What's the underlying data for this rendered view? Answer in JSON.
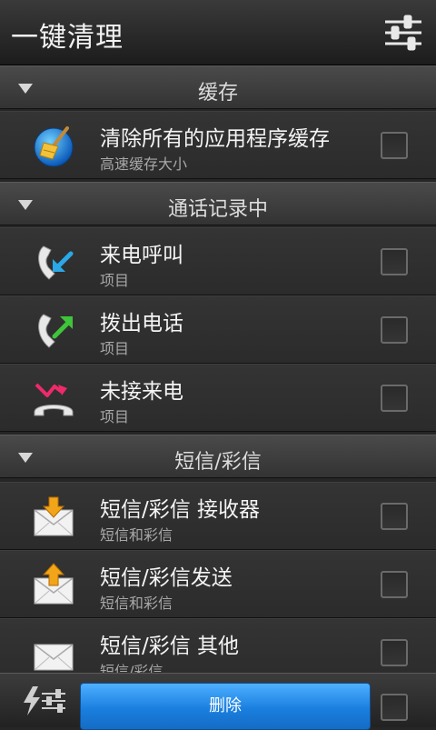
{
  "title": "一键清理",
  "sections": [
    {
      "label": "缓存",
      "items": [
        {
          "title": "清除所有的应用程序缓存",
          "subtitle": "高速缓存大小",
          "icon": "broom-icon"
        }
      ]
    },
    {
      "label": "通话记录中",
      "items": [
        {
          "title": "来电呼叫",
          "subtitle": "项目",
          "icon": "incoming-call-icon"
        },
        {
          "title": "拨出电话",
          "subtitle": "项目",
          "icon": "outgoing-call-icon"
        },
        {
          "title": "未接来电",
          "subtitle": "项目",
          "icon": "missed-call-icon"
        }
      ]
    },
    {
      "label": "短信/彩信",
      "items": [
        {
          "title": "短信/彩信 接收器",
          "subtitle": "短信和彩信",
          "icon": "inbox-mail-icon"
        },
        {
          "title": "短信/彩信发送",
          "subtitle": "短信和彩信",
          "icon": "outbox-mail-icon"
        },
        {
          "title": "短信/彩信 其他",
          "subtitle": "短信/彩信",
          "icon": "mail-icon"
        }
      ]
    }
  ],
  "bottom": {
    "delete_label": "删除"
  },
  "colors": {
    "accent": "#1a7fe0",
    "background": "#262626"
  }
}
